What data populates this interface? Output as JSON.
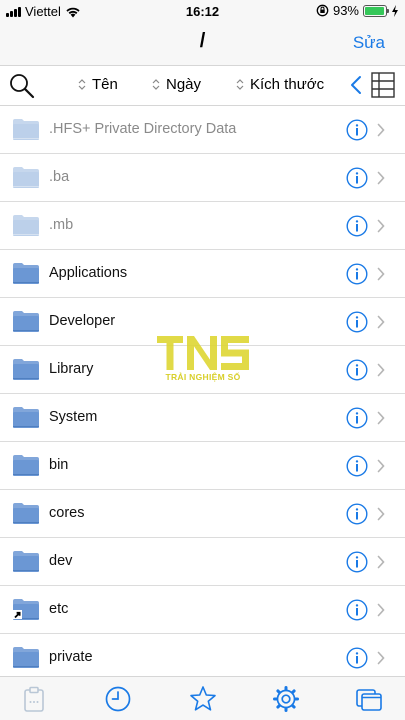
{
  "status_bar": {
    "carrier": "Viettel",
    "time": "16:12",
    "battery_percent": "93%",
    "battery_level": 0.93,
    "icons": [
      "signal-icon",
      "wifi-icon",
      "rotation-lock-icon",
      "battery-icon",
      "charging-bolt-icon"
    ]
  },
  "nav": {
    "title": "/",
    "edit_label": "Sửa"
  },
  "sort_bar": {
    "search_icon": "search-icon",
    "name_label": "Tên",
    "date_label": "Ngày",
    "size_label": "Kích thước",
    "back_icon": "chevron-left-icon",
    "layout_icon": "list-layout-icon"
  },
  "files": [
    {
      "name": ".HFS+ Private Directory Data",
      "dim": true,
      "alias": false
    },
    {
      "name": ".ba",
      "dim": true,
      "alias": false
    },
    {
      "name": ".mb",
      "dim": true,
      "alias": false
    },
    {
      "name": "Applications",
      "dim": false,
      "alias": false
    },
    {
      "name": "Developer",
      "dim": false,
      "alias": false
    },
    {
      "name": "Library",
      "dim": false,
      "alias": false
    },
    {
      "name": "System",
      "dim": false,
      "alias": false
    },
    {
      "name": "bin",
      "dim": false,
      "alias": false
    },
    {
      "name": "cores",
      "dim": false,
      "alias": false
    },
    {
      "name": "dev",
      "dim": false,
      "alias": false
    },
    {
      "name": "etc",
      "dim": false,
      "alias": true
    },
    {
      "name": "private",
      "dim": false,
      "alias": false
    }
  ],
  "watermark": {
    "logo": "TNS",
    "text": "TRẢI NGHIỆM SỐ"
  },
  "tab_bar": {
    "items": [
      "clipboard-icon",
      "recent-clock-icon",
      "favorites-star-icon",
      "settings-gear-icon",
      "windows-icon"
    ]
  },
  "colors": {
    "accent": "#1a7ae6",
    "folder": "#6b97d4",
    "folder_dim": "#bcd0ea",
    "watermark": "#d8cf2a",
    "battery": "#35c759"
  }
}
